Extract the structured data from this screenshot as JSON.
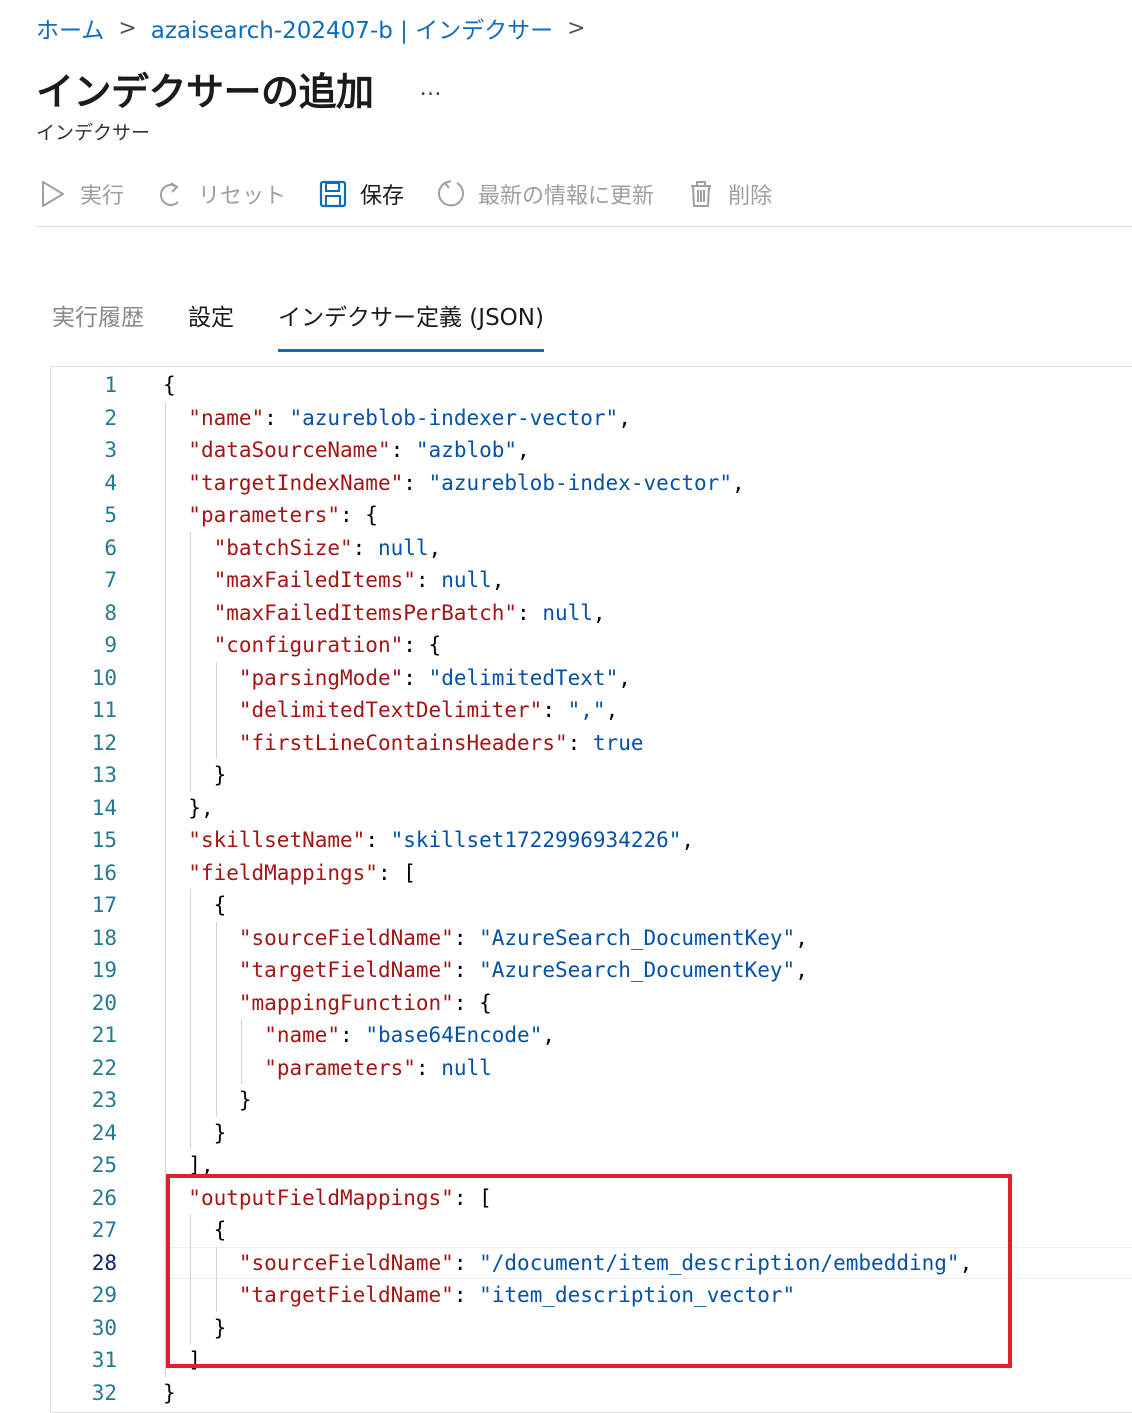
{
  "breadcrumb": {
    "home": "ホーム",
    "service": "azaisearch-202407-b | インデクサー",
    "separator": ">"
  },
  "header": {
    "title": "インデクサーの追加",
    "more": "…",
    "subtitle": "インデクサー"
  },
  "toolbar": {
    "run": "実行",
    "reset": "リセット",
    "save": "保存",
    "refresh": "最新の情報に更新",
    "delete": "削除"
  },
  "tabs": [
    {
      "label": "実行履歴",
      "state": "inactive"
    },
    {
      "label": "設定",
      "state": "normal"
    },
    {
      "label": "インデクサー定義 (JSON)",
      "state": "active"
    }
  ],
  "editor": {
    "current_line": 28,
    "highlight_color": "#e0202b",
    "lines": [
      [
        [
          "p",
          "{"
        ]
      ],
      [
        [
          "k",
          "\"name\""
        ],
        [
          "p",
          ": "
        ],
        [
          "s",
          "\"azureblob-indexer-vector\""
        ],
        [
          "p",
          ","
        ]
      ],
      [
        [
          "k",
          "\"dataSourceName\""
        ],
        [
          "p",
          ": "
        ],
        [
          "s",
          "\"azblob\""
        ],
        [
          "p",
          ","
        ]
      ],
      [
        [
          "k",
          "\"targetIndexName\""
        ],
        [
          "p",
          ": "
        ],
        [
          "s",
          "\"azureblob-index-vector\""
        ],
        [
          "p",
          ","
        ]
      ],
      [
        [
          "k",
          "\"parameters\""
        ],
        [
          "p",
          ": {"
        ]
      ],
      [
        [
          "k",
          "\"batchSize\""
        ],
        [
          "p",
          ": "
        ],
        [
          "s",
          "null"
        ],
        [
          "p",
          ","
        ]
      ],
      [
        [
          "k",
          "\"maxFailedItems\""
        ],
        [
          "p",
          ": "
        ],
        [
          "s",
          "null"
        ],
        [
          "p",
          ","
        ]
      ],
      [
        [
          "k",
          "\"maxFailedItemsPerBatch\""
        ],
        [
          "p",
          ": "
        ],
        [
          "s",
          "null"
        ],
        [
          "p",
          ","
        ]
      ],
      [
        [
          "k",
          "\"configuration\""
        ],
        [
          "p",
          ": {"
        ]
      ],
      [
        [
          "k",
          "\"parsingMode\""
        ],
        [
          "p",
          ": "
        ],
        [
          "s",
          "\"delimitedText\""
        ],
        [
          "p",
          ","
        ]
      ],
      [
        [
          "k",
          "\"delimitedTextDelimiter\""
        ],
        [
          "p",
          ": "
        ],
        [
          "s",
          "\",\""
        ],
        [
          "p",
          ","
        ]
      ],
      [
        [
          "k",
          "\"firstLineContainsHeaders\""
        ],
        [
          "p",
          ": "
        ],
        [
          "s",
          "true"
        ]
      ],
      [
        [
          "p",
          "}"
        ]
      ],
      [
        [
          "p",
          "},"
        ]
      ],
      [
        [
          "k",
          "\"skillsetName\""
        ],
        [
          "p",
          ": "
        ],
        [
          "s",
          "\"skillset1722996934226\""
        ],
        [
          "p",
          ","
        ]
      ],
      [
        [
          "k",
          "\"fieldMappings\""
        ],
        [
          "p",
          ": ["
        ]
      ],
      [
        [
          "p",
          "{"
        ]
      ],
      [
        [
          "k",
          "\"sourceFieldName\""
        ],
        [
          "p",
          ": "
        ],
        [
          "s",
          "\"AzureSearch_DocumentKey\""
        ],
        [
          "p",
          ","
        ]
      ],
      [
        [
          "k",
          "\"targetFieldName\""
        ],
        [
          "p",
          ": "
        ],
        [
          "s",
          "\"AzureSearch_DocumentKey\""
        ],
        [
          "p",
          ","
        ]
      ],
      [
        [
          "k",
          "\"mappingFunction\""
        ],
        [
          "p",
          ": {"
        ]
      ],
      [
        [
          "k",
          "\"name\""
        ],
        [
          "p",
          ": "
        ],
        [
          "s",
          "\"base64Encode\""
        ],
        [
          "p",
          ","
        ]
      ],
      [
        [
          "k",
          "\"parameters\""
        ],
        [
          "p",
          ": "
        ],
        [
          "s",
          "null"
        ]
      ],
      [
        [
          "p",
          "}"
        ]
      ],
      [
        [
          "p",
          "}"
        ]
      ],
      [
        [
          "p",
          "],"
        ]
      ],
      [
        [
          "k",
          "\"outputFieldMappings\""
        ],
        [
          "p",
          ": ["
        ]
      ],
      [
        [
          "p",
          "{"
        ]
      ],
      [
        [
          "k",
          "\"sourceFieldName\""
        ],
        [
          "p",
          ": "
        ],
        [
          "s",
          "\"/document/item_description/embedding\""
        ],
        [
          "p",
          ","
        ]
      ],
      [
        [
          "k",
          "\"targetFieldName\""
        ],
        [
          "p",
          ": "
        ],
        [
          "s",
          "\"item_description_vector\""
        ]
      ],
      [
        [
          "p",
          "}"
        ]
      ],
      [
        [
          "p",
          "]"
        ]
      ],
      [
        [
          "p",
          "}"
        ]
      ]
    ]
  }
}
